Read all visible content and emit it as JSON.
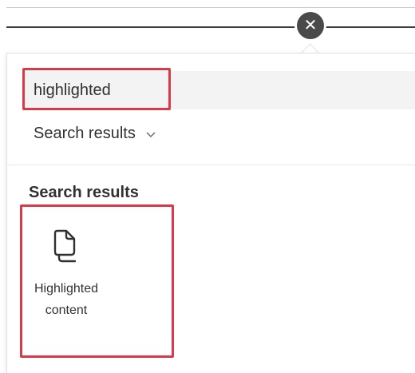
{
  "close": {
    "icon": "close-icon",
    "glyph": "✕"
  },
  "search": {
    "value": "highlighted",
    "placeholder": ""
  },
  "filter": {
    "label": "Search results",
    "icon": "chevron-down-icon"
  },
  "section": {
    "title": "Search results"
  },
  "results": [
    {
      "label": "Highlighted content",
      "icon": "document-icon"
    }
  ],
  "colors": {
    "highlight": "#d83b47",
    "close_bg": "#4a4a4a",
    "search_bg": "#f3f3f3"
  }
}
